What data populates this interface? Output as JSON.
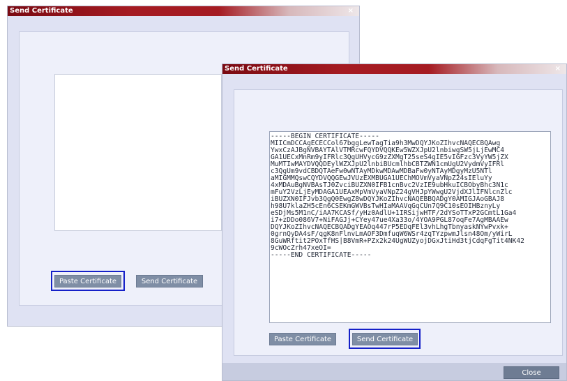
{
  "window_back": {
    "title": "Send Certificate",
    "close_glyph": "×",
    "paste_label": "Paste Certificate",
    "send_label": "Send Certificate"
  },
  "window_front": {
    "title": "Send Certificate",
    "close_glyph": "×",
    "paste_label": "Paste Certificate",
    "send_label": "Send Certificate",
    "close_label": "Close",
    "certificate_text": "-----BEGIN CERTIFICATE-----\nMIICmDCCAgECECCol67bggLewTagTia9h3MwDQYJKoZIhvcNAQECBQAwg\nYwxCzAJBgNVBAYTAlVTMRcwFQYDVQQKEw5WZXJpU2lnbiwgSW5jLjEwMC4\nGA1UECxMnRm9yIFRlc3QgUHVycG9zZXMgT25seS4gIE5vIGFzc3VyYW5jZX\nMuMTIwMAYDVQQDEylWZXJpU2lnbiBUcmlhbCBTZWN1cmUgU2VydmVyIFRl\nc3QgUm9vdCBDQTAeFw0wNTAyMDkwMDAwMDBaFw0yNTAyMDgyMzU5NTl\naMIGMMQswCQYDVQQGEwJVUzEXMBUGA1UEChMOVmVyaVNpZ24sIEluYy\n4xMDAuBgNVBAsTJ0ZvciBUZXN0IFB1cnBvc2VzIE9ubHkuICBObyBhc3N1c\nmFuY2VzLjEyMDAGA1UEAxMpVmVyaVNpZ24gVHJpYWwgU2VjdXJlIFNlcnZlc\niBUZXN0IFJvb3QgQ0EwgZ8wDQYJKoZIhvcNAQEBBQADgY0AMIGJAoGBAJ8\nh98U7klaZH5cEn6CSEKmGWVBsTwHIaMAAVqGqCUn7Q9C10sEOIHBznyLy\neSDjMs5M1nC/iAA7KCASf/yHz0AdlU+1IRSijwHTF/2dYSoTTxP2GCmtL1Ga4\ni7+zDDo086V7+NiFAGJj+CYey47ue4Xa33o/4YOA9PGL87oqFe7AgMBAAEw\nDQYJKoZIhvcNAQECBQADgYEAOq447rP5EDqFEl3vhLhgTbnyaskNYwPvxk+\n0grnQyDA4sF/qgK8nFlnvLmAOF3DmfuqW6WSr4zqTYzpwmJlsn48Om/yWirL\n8GuWRftit2POxTfHS|B8VmR+PZx2k24UgWUZyojDGxJtiHd3tjCdqFgTit4NK42\n9cWOcZrh47xeOI=\n-----END CERTIFICATE-----"
  }
}
